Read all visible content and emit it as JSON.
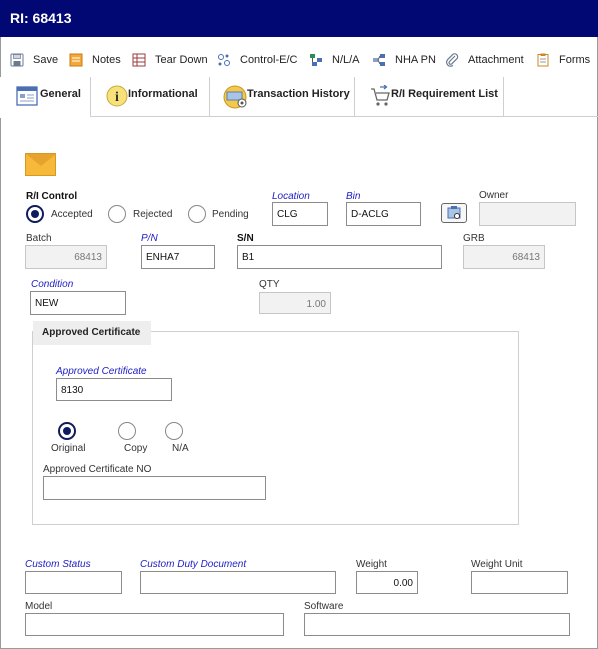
{
  "window": {
    "title": "RI: 68413"
  },
  "toolbar": {
    "items": [
      {
        "label": "Save",
        "icon": "save-icon"
      },
      {
        "label": "Notes",
        "icon": "notes-icon"
      },
      {
        "label": "Tear Down",
        "icon": "tear-down-icon"
      },
      {
        "label": "Control-E/C",
        "icon": "control-ec-icon"
      },
      {
        "label": "N/L/A",
        "icon": "nla-icon"
      },
      {
        "label": "NHA PN",
        "icon": "nha-pn-icon"
      },
      {
        "label": "Attachment",
        "icon": "paperclip-icon"
      },
      {
        "label": "Forms",
        "icon": "forms-icon"
      }
    ]
  },
  "tabs": [
    {
      "label": "General",
      "active": true
    },
    {
      "label": "Informational",
      "active": false
    },
    {
      "label": "Transaction History",
      "active": false
    },
    {
      "label": "R/I Requirement List",
      "active": false
    }
  ],
  "form": {
    "ri_control": {
      "label": "R/I Control",
      "options": [
        "Accepted",
        "Rejected",
        "Pending"
      ],
      "selected": "Accepted"
    },
    "location": {
      "label": "Location",
      "value": "CLG"
    },
    "bin": {
      "label": "Bin",
      "value": "D-ACLG"
    },
    "owner": {
      "label": "Owner",
      "value": ""
    },
    "batch": {
      "label": "Batch",
      "value": "68413"
    },
    "pn": {
      "label": "P/N",
      "value": "ENHA7"
    },
    "sn": {
      "label": "S/N",
      "value": "B1"
    },
    "grb": {
      "label": "GRB",
      "value": "68413"
    },
    "condition": {
      "label": "Condition",
      "value": "NEW"
    },
    "qty": {
      "label": "QTY",
      "value": "1.00"
    },
    "approved_certificate_group": {
      "legend": "Approved Certificate",
      "certificate": {
        "label": "Approved Certificate",
        "value": "8130"
      },
      "options": [
        "Original",
        "Copy",
        "N/A"
      ],
      "selected": "Original",
      "cert_no": {
        "label": "Approved Certificate NO",
        "value": ""
      }
    },
    "custom_status": {
      "label": "Custom Status",
      "value": ""
    },
    "custom_duty_document": {
      "label": "Custom Duty Document",
      "value": ""
    },
    "weight": {
      "label": "Weight",
      "value": "0.00"
    },
    "weight_unit": {
      "label": "Weight Unit",
      "value": ""
    },
    "model": {
      "label": "Model",
      "value": ""
    },
    "software": {
      "label": "Software",
      "value": ""
    }
  },
  "colors": {
    "title_bar": "#020873",
    "required_label": "#1d1dc4",
    "radio_selected": "#0f1c5c"
  }
}
